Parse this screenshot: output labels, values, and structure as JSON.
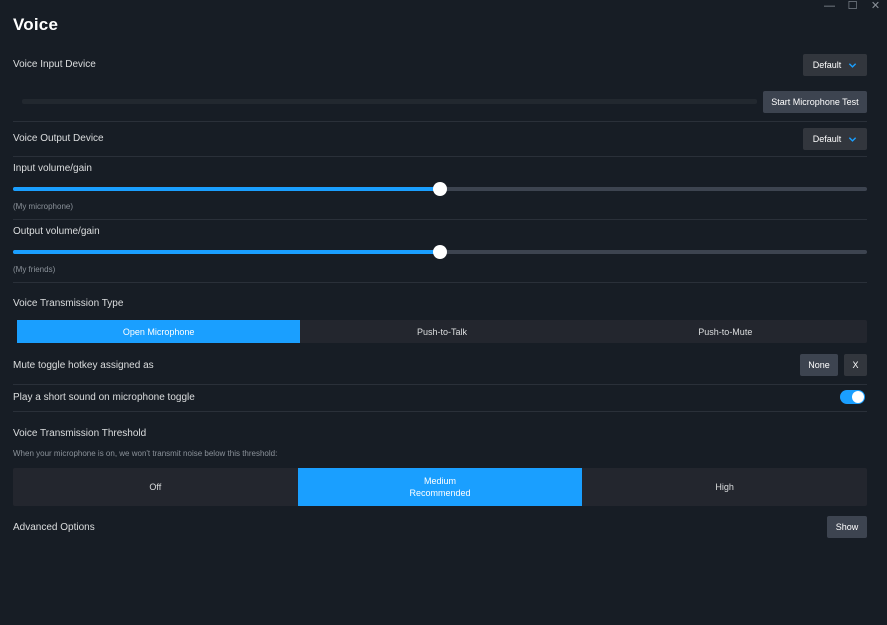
{
  "window": {
    "minimize_glyph": "—",
    "maximize_glyph": "☐",
    "close_glyph": "✕"
  },
  "page": {
    "title": "Voice"
  },
  "voice_input": {
    "label": "Voice Input Device",
    "device": "Default",
    "mic_test_label": "Start Microphone Test"
  },
  "voice_output": {
    "label": "Voice Output Device",
    "device": "Default"
  },
  "input_volume": {
    "label": "Input volume/gain",
    "sublabel": "(My microphone)",
    "value_fraction": 0.5
  },
  "output_volume": {
    "label": "Output volume/gain",
    "sublabel": "(My friends)",
    "value_fraction": 0.5
  },
  "transmission_type": {
    "label": "Voice Transmission Type",
    "options": [
      "Open Microphone",
      "Push-to-Talk",
      "Push-to-Mute"
    ],
    "selected": "Open Microphone"
  },
  "mute_hotkey": {
    "label": "Mute toggle hotkey assigned as",
    "value": "None",
    "clear_label": "X"
  },
  "toggle_sound": {
    "label": "Play a short sound on microphone toggle",
    "enabled": true
  },
  "threshold": {
    "label": "Voice Transmission Threshold",
    "description": "When your microphone is on, we won't transmit noise below this threshold:",
    "options": [
      {
        "line1": "Off",
        "line2": ""
      },
      {
        "line1": "Medium",
        "line2": "Recommended"
      },
      {
        "line1": "High",
        "line2": ""
      }
    ],
    "selected": "Medium"
  },
  "advanced": {
    "label": "Advanced Options",
    "button": "Show"
  },
  "colors": {
    "background": "#171d25",
    "accent": "#1a9fff",
    "control_bg": "#3d4450",
    "text": "#dcdedf",
    "muted_text": "#8b929a"
  }
}
